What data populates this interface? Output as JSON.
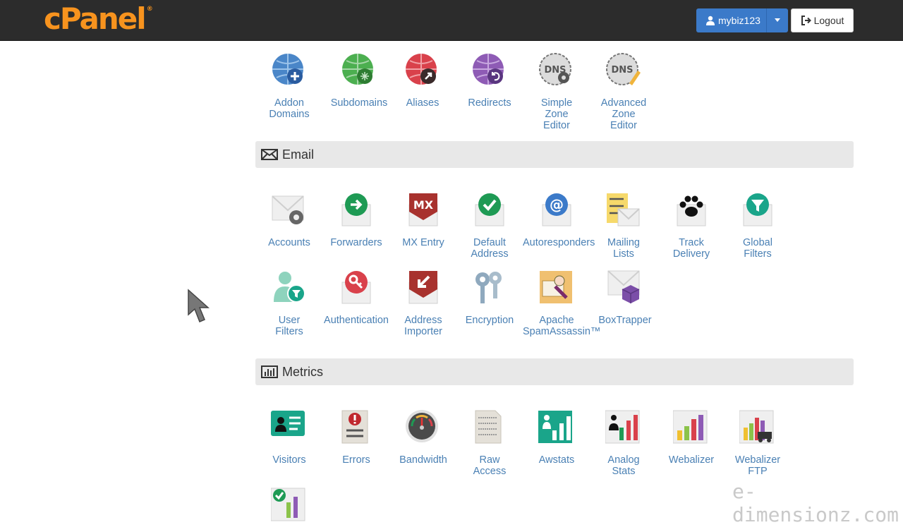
{
  "header": {
    "logo": "cPanel",
    "logo_mark": "®",
    "username": "mybiz123",
    "logout": "Logout"
  },
  "domains": {
    "tiles": [
      {
        "label": "Addon\nDomains",
        "icon": "globe-plus-icon"
      },
      {
        "label": "Subdomains",
        "icon": "globe-network-icon"
      },
      {
        "label": "Aliases",
        "icon": "globe-arrow-icon"
      },
      {
        "label": "Redirects",
        "icon": "globe-return-icon"
      },
      {
        "label": "Simple\nZone\nEditor",
        "icon": "dns-gear-icon"
      },
      {
        "label": "Advanced\nZone\nEditor",
        "icon": "dns-pencil-icon"
      }
    ]
  },
  "email": {
    "title": "Email",
    "tiles": [
      {
        "label": "Accounts",
        "icon": "envelope-gear-icon"
      },
      {
        "label": "Forwarders",
        "icon": "envelope-arrow-icon"
      },
      {
        "label": "MX Entry",
        "icon": "envelope-mx-icon"
      },
      {
        "label": "Default\nAddress",
        "icon": "envelope-check-icon"
      },
      {
        "label": "Autoresponders",
        "icon": "envelope-at-icon"
      },
      {
        "label": "Mailing\nLists",
        "icon": "mailing-list-icon"
      },
      {
        "label": "Track\nDelivery",
        "icon": "paw-print-icon"
      },
      {
        "label": "Global\nFilters",
        "icon": "envelope-filter-icon"
      },
      {
        "label": "User\nFilters",
        "icon": "user-filter-icon"
      },
      {
        "label": "Authentication",
        "icon": "envelope-key-icon"
      },
      {
        "label": "Address\nImporter",
        "icon": "envelope-import-icon"
      },
      {
        "label": "Encryption",
        "icon": "keys-icon"
      },
      {
        "label": "Apache\nSpamAssassin™",
        "icon": "spamassassin-icon"
      },
      {
        "label": "BoxTrapper",
        "icon": "envelope-cube-icon"
      }
    ]
  },
  "metrics": {
    "title": "Metrics",
    "tiles": [
      {
        "label": "Visitors",
        "icon": "visitor-card-icon"
      },
      {
        "label": "Errors",
        "icon": "error-document-icon"
      },
      {
        "label": "Bandwidth",
        "icon": "gauge-icon"
      },
      {
        "label": "Raw\nAccess",
        "icon": "raw-log-icon"
      },
      {
        "label": "Awstats",
        "icon": "awstats-icon"
      },
      {
        "label": "Analog\nStats",
        "icon": "analog-stats-icon"
      },
      {
        "label": "Webalizer",
        "icon": "webalizer-icon"
      },
      {
        "label": "Webalizer\nFTP",
        "icon": "webalizer-ftp-icon"
      }
    ]
  },
  "watermark": "e-dimensionz.com",
  "colors": {
    "accent": "#3b7ac9",
    "brand": "#f7931e",
    "link": "#4a80b4"
  }
}
